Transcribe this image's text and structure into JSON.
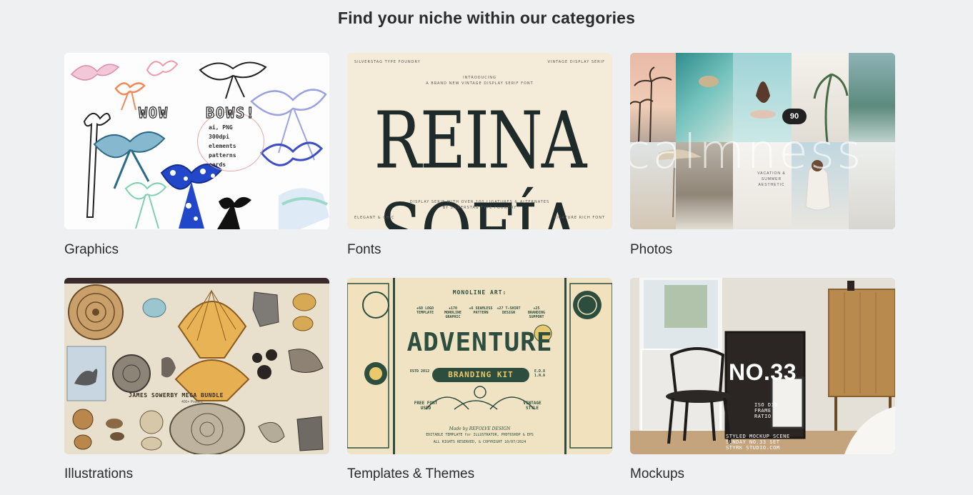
{
  "heading": "Find your niche within our categories",
  "categories": [
    {
      "label": "Graphics"
    },
    {
      "label": "Fonts"
    },
    {
      "label": "Photos"
    },
    {
      "label": "Illustrations"
    },
    {
      "label": "Templates & Themes"
    },
    {
      "label": "Mockups"
    }
  ],
  "thumbnails": {
    "graphics": {
      "word1": "WOW",
      "word2": "BOWS!",
      "meta": [
        "ai, PNG",
        "300dpi",
        "elements",
        "patterns",
        "cards"
      ]
    },
    "fonts": {
      "top_left": "SILVERSTAG TYPE FOUNDRY",
      "top_right": "VINTAGE DISPLAY SERIF",
      "intro": "INTRODUCING",
      "sub": "A BRAND NEW VINTAGE DISPLAY SERIF FONT",
      "title": "REINA SOFÍA",
      "desc": "DISPLAY SERIF WITH OVER 100 LIGATURES & ALTERNATES",
      "by": "BY SILVERSTAG TYPE FOUNDRY",
      "bottom_left": "ELEGANT & CHIC",
      "bottom_right": "LIGATURE RICH FONT"
    },
    "photos": {
      "script": "calmness",
      "badge": "90",
      "caption": "VACATION & SUMMER AESTHETIC"
    },
    "illustrations": {
      "bundle": "JAMES SOWERBY MEGA BUNDLE",
      "posters": "400+ Posters"
    },
    "templates": {
      "mono": "MONOLINE ART:",
      "stats": [
        "+60 LOGO TEMPLATE",
        "+170 MONOLINE GRAPHIC",
        "+6 SEAMLESS PATTERN",
        "+27 T-SHIRT DESIGN",
        "+25 BRANDING SUPPORT"
      ],
      "title": "ADVENTURE",
      "kit": "BRANDING KIT",
      "est": "ESTD 2012",
      "coords": "E.D.8 1.N.A",
      "free": "FREE FONT USED",
      "vintage": "VINTAGE STYLE",
      "madeby": "Made by REFOLVE DESIGN",
      "foot1": "EDITABLE TEMPLATE for ILLUSTRATOR, PHOTOSHOP & EPS",
      "foot2": "ALL RIGHTS RESERVED, & COPYRIGHT 10/07/2024"
    },
    "mockups": {
      "title": "NO.33",
      "iso": "ISO DIN FRAME RATIO",
      "footer": [
        "STYLED  MOCKUP  SCENE",
        "SUNDAY  NO.33  SET",
        "STYRK STUDIO.COM"
      ]
    }
  },
  "colors": {
    "background": "#eef0f2",
    "text": "#2b2b2b",
    "template_green": "#2d4e3f",
    "template_gold": "#e9c96b"
  }
}
